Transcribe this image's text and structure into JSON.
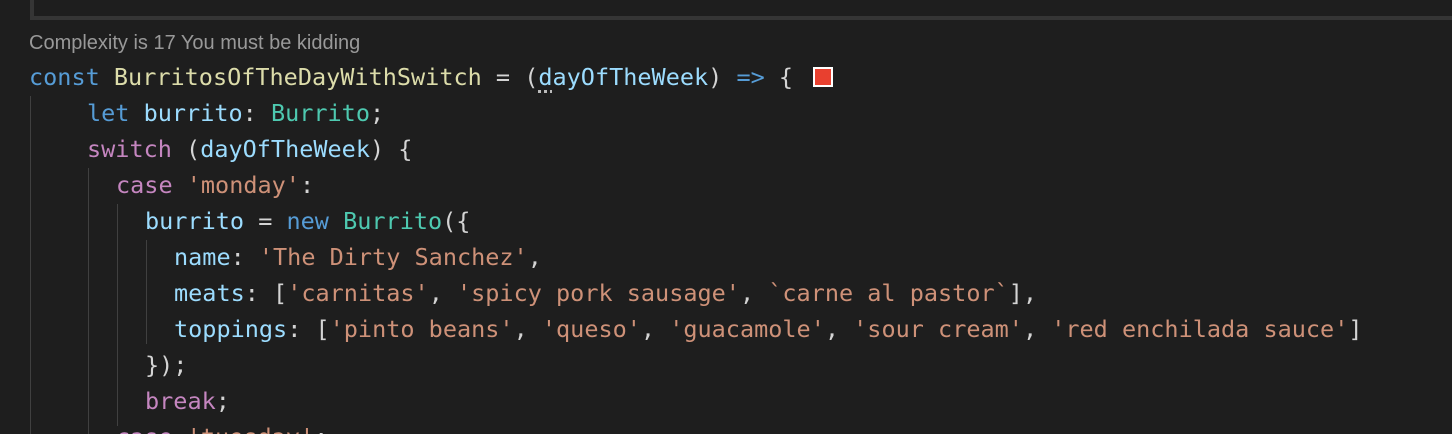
{
  "codelens": {
    "text": "Complexity is 17 You must be kidding"
  },
  "code": {
    "l1": {
      "const": "const",
      "fn": "BurritosOfTheDayWithSwitch",
      "eq": " = (",
      "param_dots": "d",
      "param_rest": "ayOfTheWeek",
      "close": ") ",
      "arrow": "=>",
      "brace": " {",
      "swatch_color": "#e8402f"
    },
    "l2": {
      "let": "let",
      "var": " burrito",
      "colon": ": ",
      "type": "Burrito",
      "semi": ";"
    },
    "l3": {
      "switch": "switch",
      "open": " (",
      "arg": "dayOfTheWeek",
      "close": ") {"
    },
    "l4": {
      "case": "case",
      "space": " ",
      "str": "'monday'",
      "colon": ":"
    },
    "l5": {
      "var": "burrito",
      "eq": " = ",
      "new": "new",
      "space": " ",
      "cls": "Burrito",
      "open": "({"
    },
    "l6": {
      "key": "name",
      "colon": ": ",
      "str": "'The Dirty Sanchez'",
      "comma": ","
    },
    "l7": {
      "key": "meats",
      "colon": ": [",
      "s1": "'carnitas'",
      "sep1": ", ",
      "s2": "'spicy pork sausage'",
      "sep2": ", ",
      "s3": "`carne al pastor`",
      "end": "],"
    },
    "l8": {
      "key": "toppings",
      "colon": ": [",
      "s1": "'pinto beans'",
      "sep1": ", ",
      "s2": "'queso'",
      "sep2": ", ",
      "s3": "'guacamole'",
      "sep3": ", ",
      "s4": "'sour cream'",
      "sep4": ", ",
      "s5": "'red enchilada sauce'",
      "end": "]"
    },
    "l9": {
      "text": "});"
    },
    "l10": {
      "brk": "break",
      "semi": ";"
    },
    "l11": {
      "case": "case",
      "space": " ",
      "str": "'tuesday'",
      "colon": ":"
    }
  }
}
